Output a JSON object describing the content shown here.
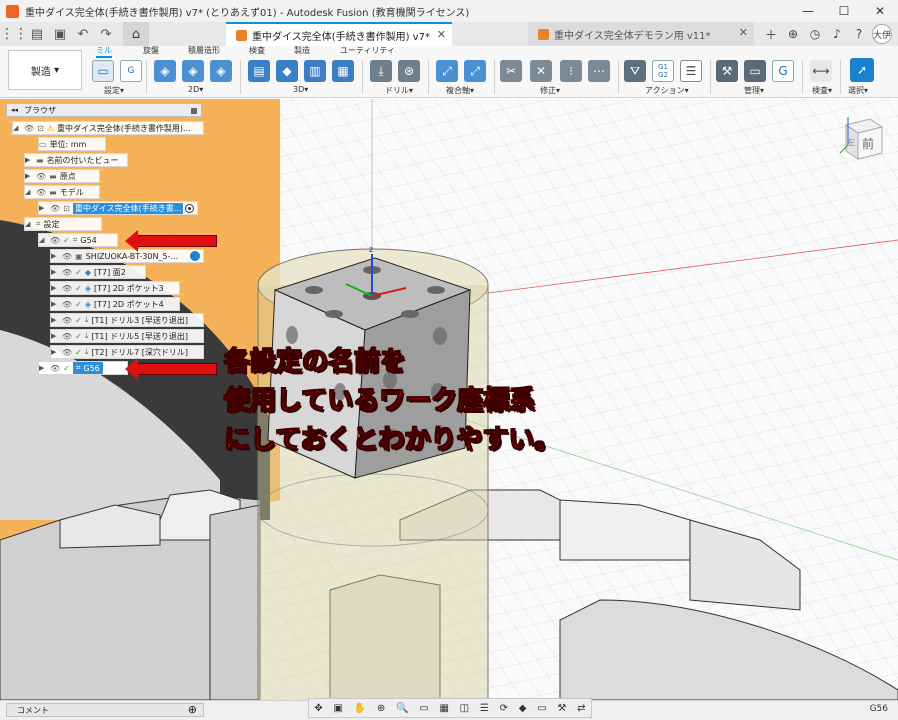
{
  "window": {
    "title": "重中ダイス完全体(手続き書作製用) v7* (とりあえず01) - Autodesk Fusion (教育機関ライセンス)",
    "controls": [
      "—",
      "☐",
      "✕"
    ]
  },
  "tabs": [
    {
      "label": "重中ダイス完全体(手続き書作製用) v7*",
      "active": true
    },
    {
      "label": "重中ダイス完全体デモラン用 v11*",
      "active": false
    }
  ],
  "user": {
    "avatar": "大伊"
  },
  "ribbon": {
    "workspace": "製造",
    "tabs": [
      "ミル",
      "旋盤",
      "積層造形",
      "検査",
      "製造",
      "ユーティリティ"
    ],
    "groups": [
      "設定",
      "2D",
      "3D",
      "ドリル",
      "複合軸",
      "修正",
      "アクション",
      "管理",
      "検査",
      "選択"
    ],
    "group_button_text": {
      "g1g2": "G1\nG2"
    }
  },
  "browser": {
    "title": "ブラウザ",
    "items": [
      {
        "label": "重中ダイス完全体(手続き書作製用)...",
        "icon": "warning-icon"
      },
      {
        "label": "単位: mm",
        "icon": "document-icon"
      },
      {
        "label": "名前の付いたビュー",
        "icon": "folder-icon"
      },
      {
        "label": "原点",
        "icon": "folder-icon"
      },
      {
        "label": "モデル",
        "icon": "folder-icon"
      },
      {
        "label": "重中ダイス完全体(手続き書...",
        "icon": "component-icon",
        "highlight": true
      },
      {
        "label": "設定",
        "icon": "setup-icon"
      },
      {
        "label": "G54",
        "icon": "setup-icon"
      },
      {
        "label": "SHIZUOKA-BT-30N_5-...",
        "icon": "machine-icon"
      },
      {
        "label": "[T7] 面2",
        "icon": "face-op-icon"
      },
      {
        "label": "[T7] 2D ポケット3",
        "icon": "pocket-op-icon"
      },
      {
        "label": "[T7] 2D ポケット4",
        "icon": "pocket-op-icon"
      },
      {
        "label": "[T1] ドリル3 [早送り退出]",
        "icon": "drill-op-icon"
      },
      {
        "label": "[T1] ドリル5 [早送り退出]",
        "icon": "drill-op-icon"
      },
      {
        "label": "[T2] ドリル7 [深穴ドリル]",
        "icon": "drill-op-icon"
      },
      {
        "label": "G56",
        "icon": "setup-icon",
        "selected": true
      }
    ]
  },
  "annotation": {
    "lines": [
      "各設定の名前を",
      "使用しているワーク座標系",
      "にしておくとわかりやすい。"
    ]
  },
  "viewcube": {
    "face": "前",
    "side": "左"
  },
  "comments": {
    "label": "コメント"
  },
  "status": {
    "setup": "G56"
  },
  "colors": {
    "accent": "#0696d7",
    "annotation": "#e01010",
    "setup_bg": "#f4a43b"
  }
}
